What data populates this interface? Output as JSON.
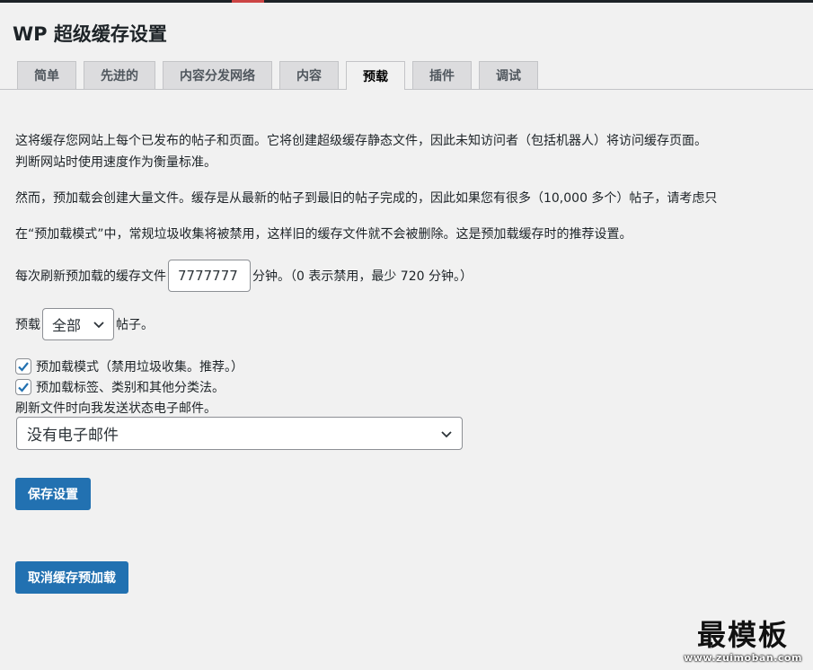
{
  "page": {
    "title": "WP 超级缓存设置"
  },
  "tabs": [
    {
      "label": "简单",
      "active": false
    },
    {
      "label": "先进的",
      "active": false
    },
    {
      "label": "内容分发网络",
      "active": false
    },
    {
      "label": "内容",
      "active": false
    },
    {
      "label": "预载",
      "active": true
    },
    {
      "label": "插件",
      "active": false
    },
    {
      "label": "调试",
      "active": false
    }
  ],
  "intro": {
    "line1": "这将缓存您网站上每个已发布的帖子和页面。它将创建超级缓存静态文件，因此未知访问者（包括机器人）将访问缓存页面。",
    "line2": "判断网站时使用速度作为衡量标准。",
    "line3": "然而，预加载会创建大量文件。缓存是从最新的帖子到最旧的帖子完成的，因此如果您有很多（10,000 多个）帖子，请考虑只",
    "line4": "在“预加载模式”中，常规垃圾收集将被禁用，这样旧的缓存文件就不会被删除。这是预加载缓存时的推荐设置。"
  },
  "refresh": {
    "label_before": "每次刷新预加载的缓存文件",
    "value": "7777777",
    "label_after": "分钟。（0 表示禁用，最少 720 分钟。）"
  },
  "preload_count": {
    "label_before": "预载",
    "selected": "全部",
    "label_after": "帖子。"
  },
  "options": {
    "preload_mode": {
      "label": "预加载模式（禁用垃圾收集。推荐。）",
      "checked": true
    },
    "preload_taxonomies": {
      "label": "预加载标签、类别和其他分类法。",
      "checked": true
    }
  },
  "email": {
    "label": "刷新文件时向我发送状态电子邮件。",
    "selected": "没有电子邮件"
  },
  "buttons": {
    "save": "保存设置",
    "cancel_preload": "取消缓存预加载"
  },
  "watermark": {
    "main": "最模板",
    "sub": "www.zuimoban.com"
  },
  "colors": {
    "primary_button": "#2271b1",
    "background": "#f1f1f1",
    "checkbox_check": "#2271b1"
  }
}
